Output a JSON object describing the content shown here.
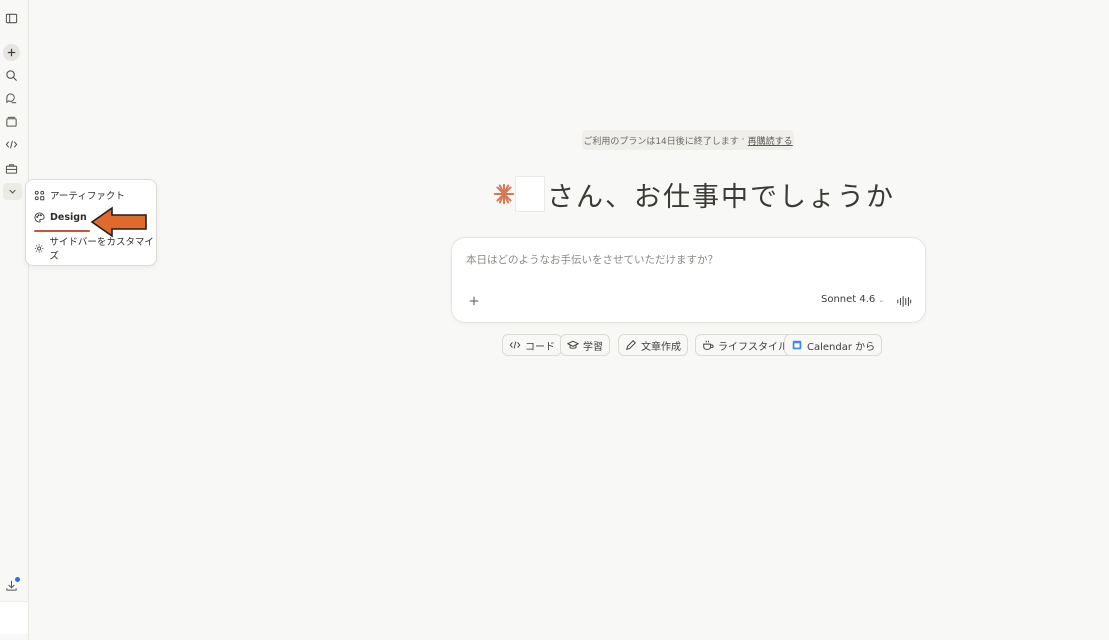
{
  "sidebar": {
    "icons": [
      "panel-toggle-icon",
      "new-chat-icon",
      "search-icon",
      "chats-icon",
      "projects-icon",
      "code-icon",
      "briefcase-icon",
      "chevron-down-icon"
    ],
    "download_icon": "download-icon"
  },
  "menu": {
    "items": [
      {
        "label": "アーティファクト",
        "icon": "artifacts-icon"
      },
      {
        "label": "Design",
        "icon": "palette-icon"
      },
      {
        "label": "サイドバーをカスタマイズ",
        "icon": "gear-icon"
      }
    ],
    "active_index": 1
  },
  "banner": {
    "text": "ご利用のプランは14日後に終了します",
    "separator": "·",
    "link": "再購読する"
  },
  "greeting": {
    "text": "さん、お仕事中でしょうか"
  },
  "composer": {
    "placeholder": "本日はどのようなお手伝いをさせていただけますか？",
    "model": "Sonnet 4.6",
    "model_chevron": "⌄"
  },
  "chips": [
    {
      "label": "コード",
      "icon": "code-icon"
    },
    {
      "label": "学習",
      "icon": "graduation-cap-icon"
    },
    {
      "label": "文章作成",
      "icon": "pen-icon"
    },
    {
      "label": "ライフスタイル",
      "icon": "coffee-icon"
    },
    {
      "label": "Calendar から",
      "icon": "calendar-icon"
    }
  ],
  "colors": {
    "accent": "#d97757",
    "arrow": "#e06a2e",
    "underline": "#c5563a",
    "background": "#f8f8f6"
  }
}
